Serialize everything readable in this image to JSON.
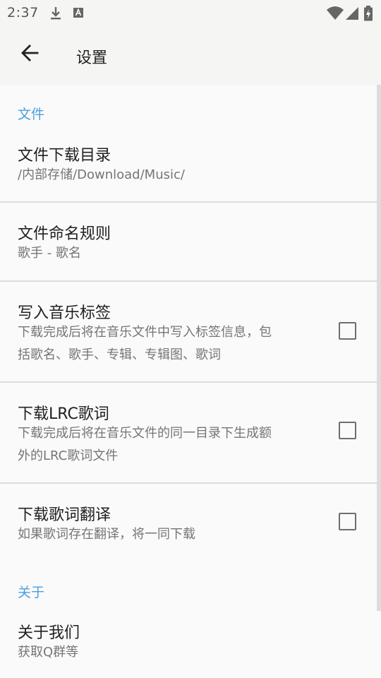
{
  "status_bar": {
    "time": "2:37",
    "icons": [
      "download-icon",
      "font-a-icon",
      "wifi-icon",
      "cellular-signal-icon",
      "battery-charging-icon"
    ]
  },
  "app_bar": {
    "title": "设置",
    "back_icon": "arrow-back-icon"
  },
  "sections": [
    {
      "header": "文件",
      "items": [
        {
          "title": "文件下载目录",
          "summary": "/内部存储/Download/Music/",
          "has_checkbox": false
        },
        {
          "title": "文件命名规则",
          "summary": "歌手 - 歌名",
          "has_checkbox": false
        },
        {
          "title": "写入音乐标签",
          "summary_lines": [
            "下载完成后将在音乐文件中写入标签信息，包",
            "括歌名、歌手、专辑、专辑图、歌词"
          ],
          "has_checkbox": true,
          "checked": false
        },
        {
          "title": "下载LRC歌词",
          "summary_lines": [
            "下载完成后将在音乐文件的同一目录下生成额",
            "外的LRC歌词文件"
          ],
          "has_checkbox": true,
          "checked": false
        },
        {
          "title": "下载歌词翻译",
          "summary": "如果歌词存在翻译，将一同下载",
          "has_checkbox": true,
          "checked": false
        }
      ]
    },
    {
      "header": "关于",
      "items": [
        {
          "title": "关于我们",
          "summary": "获取Q群等",
          "has_checkbox": false
        }
      ]
    }
  ],
  "colors": {
    "accent": "#4a9fe0",
    "bar_background": "#f5f5f3",
    "page_background": "#fafafa",
    "divider": "#dcdcdc"
  }
}
